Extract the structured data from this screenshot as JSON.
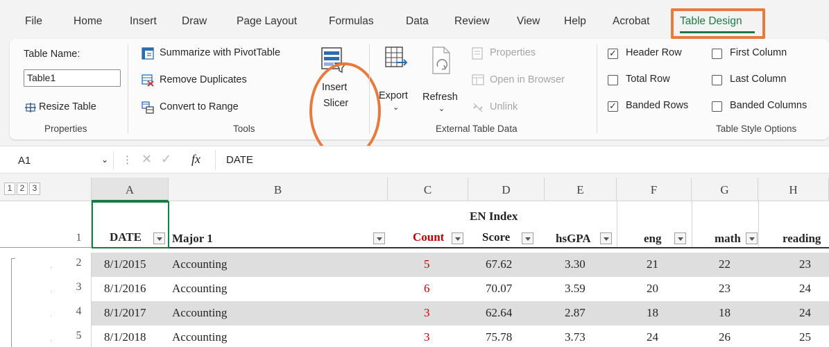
{
  "tabs": [
    "File",
    "Home",
    "Insert",
    "Draw",
    "Page Layout",
    "Formulas",
    "Data",
    "Review",
    "View",
    "Help",
    "Acrobat",
    "Table Design"
  ],
  "properties": {
    "table_name_label": "Table Name:",
    "table_name_value": "Table1",
    "resize_label": "Resize Table",
    "group_label": "Properties"
  },
  "tools": {
    "summarize": "Summarize with PivotTable",
    "remove_duplicates": "Remove Duplicates",
    "convert": "Convert to Range",
    "insert_slicer_line1": "Insert",
    "insert_slicer_line2": "Slicer",
    "group_label": "Tools"
  },
  "external": {
    "export": "Export",
    "refresh": "Refresh",
    "properties": "Properties",
    "open_in_browser": "Open in Browser",
    "unlink": "Unlink",
    "group_label": "External Table Data"
  },
  "style_options": {
    "header_row": "Header Row",
    "total_row": "Total Row",
    "banded_rows": "Banded Rows",
    "first_column": "First Column",
    "last_column": "Last Column",
    "banded_columns": "Banded Columns",
    "group_label": "Table Style Options",
    "header_row_checked": true,
    "total_row_checked": false,
    "banded_rows_checked": true,
    "first_column_checked": false,
    "last_column_checked": false,
    "banded_columns_checked": false
  },
  "formula_bar": {
    "cell_ref": "A1",
    "fx": "fx",
    "value": "DATE"
  },
  "outline_levels": [
    "1",
    "2",
    "3"
  ],
  "columns": [
    "A",
    "B",
    "C",
    "D",
    "E",
    "F",
    "G",
    "H"
  ],
  "row_numbers": [
    "1",
    "2",
    "3",
    "4",
    "5"
  ],
  "headers": {
    "a": "DATE",
    "b": "Major 1",
    "c": "Count",
    "d_line1": "EN Index",
    "d_line2": "Score",
    "e": "hsGPA",
    "f": "eng",
    "g": "math",
    "h": "reading"
  },
  "rows": [
    {
      "date": "8/1/2015",
      "major": "Accounting",
      "count": "5",
      "en": "67.62",
      "gpa": "3.30",
      "eng": "21",
      "math": "22",
      "reading": "23"
    },
    {
      "date": "8/1/2016",
      "major": "Accounting",
      "count": "6",
      "en": "70.07",
      "gpa": "3.59",
      "eng": "20",
      "math": "23",
      "reading": "24"
    },
    {
      "date": "8/1/2017",
      "major": "Accounting",
      "count": "3",
      "en": "62.64",
      "gpa": "2.87",
      "eng": "18",
      "math": "18",
      "reading": "24"
    },
    {
      "date": "8/1/2018",
      "major": "Accounting",
      "count": "3",
      "en": "75.78",
      "gpa": "3.73",
      "eng": "24",
      "math": "26",
      "reading": "25"
    }
  ]
}
